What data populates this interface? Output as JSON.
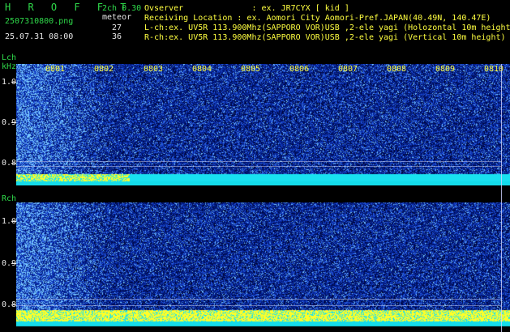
{
  "app": {
    "title": "H R O F F T",
    "version": "2ch 0.30",
    "mode": "meteor"
  },
  "file": {
    "name": "2507310800.png",
    "datetime": "25.07.31 08:00"
  },
  "counts": {
    "lch": "27",
    "rch": "36"
  },
  "header": {
    "observer": "Ovserver              : ex. JR7CYX [ kid ]",
    "location": "Receiving Location : ex. Aomori City Aomori-Pref.JAPAN(40.49N, 140.47E)",
    "lch": "L-ch:ex. UV5R 113.900Mhz(SAPPORO VOR)USB ,2-ele yagi (Holozontal 10m height)",
    "rch": "R-ch:ex. UV5R 113.900Mhz(SAPPORO VOR)USB ,2-ele yagi (Vertical 10m height)"
  },
  "lch_panel": {
    "label": "Lch",
    "unit": "kHz",
    "yticks": [
      "1.0",
      "0.9",
      "0.8"
    ]
  },
  "rch_panel": {
    "label": "Rch",
    "yticks": [
      "1.0",
      "0.9",
      "0.8"
    ]
  },
  "time_ticks": [
    "0801",
    "0802",
    "0803",
    "0804",
    "0805",
    "0806",
    "0807",
    "0808",
    "0809",
    "0810"
  ],
  "colors": {
    "background": "#000000",
    "noise_dark": "#001a80",
    "noise_mid": "#1f4fd8",
    "noise_hi": "#69c8ff",
    "baseline_cyan": "#18e6f0",
    "baseline_yellow": "#ffff30",
    "title_green": "#2fd94a",
    "tick_yellow": "#ffff40"
  }
}
